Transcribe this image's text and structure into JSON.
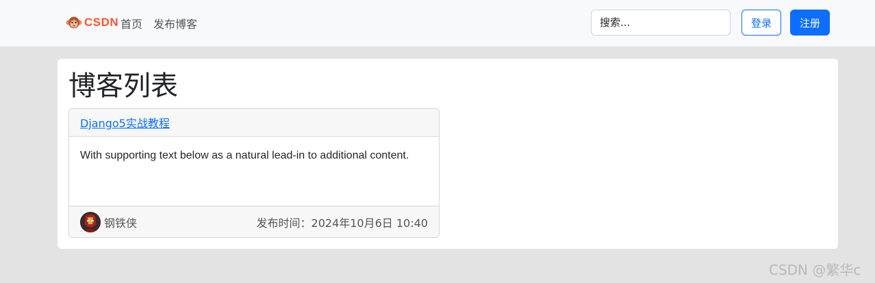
{
  "navbar": {
    "brand": {
      "logo_text": "CSDN",
      "logo_icon": "csdn-monkey-icon"
    },
    "links": [
      "首页",
      "发布博客"
    ],
    "search": {
      "placeholder": "搜索...",
      "value": ""
    },
    "login_label": "登录",
    "register_label": "注册"
  },
  "main": {
    "title": "博客列表",
    "cards": [
      {
        "title": "Django5实战教程",
        "body": "With supporting text below as a natural lead-in to additional content.",
        "author": "钢铁侠",
        "published": "发布时间：2024年10月6日 10:40"
      }
    ]
  },
  "watermark": "CSDN @繁华c",
  "colors": {
    "primary": "#0d6efd",
    "brand": "#fc5531",
    "page_bg": "#e3e3e3"
  }
}
